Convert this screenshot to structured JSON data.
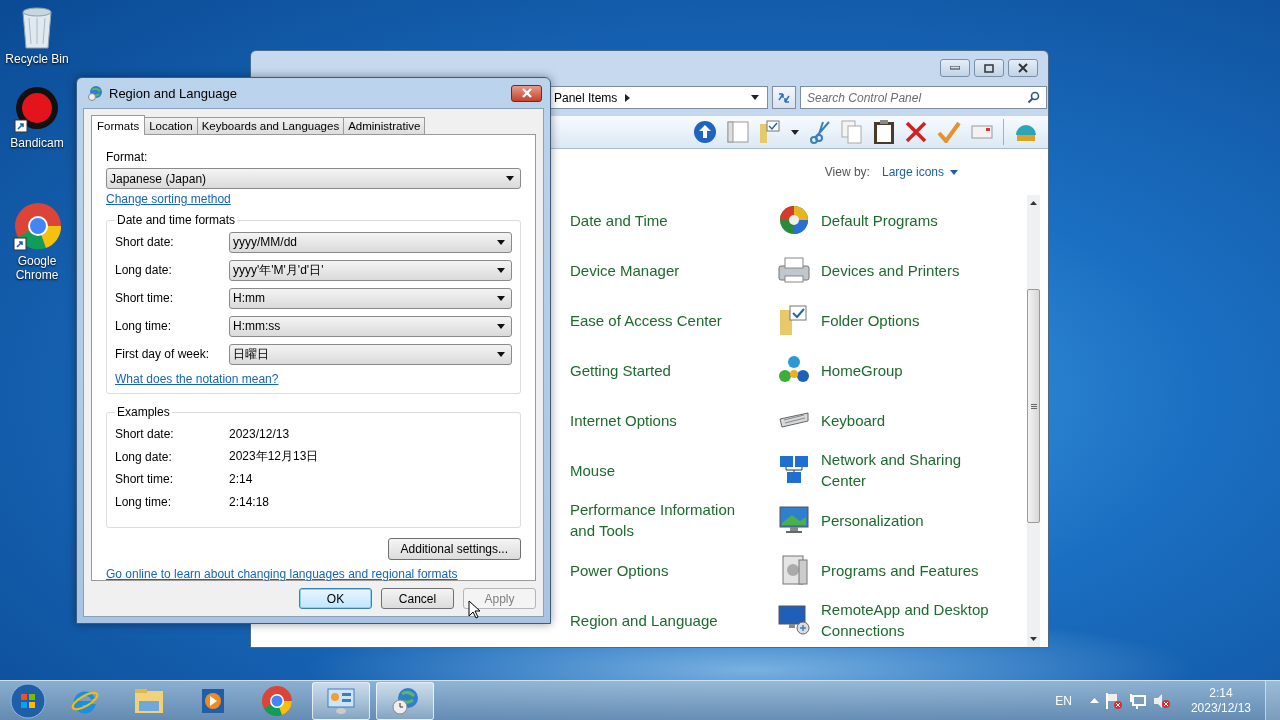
{
  "desktop_icons": [
    {
      "label": "Recycle Bin"
    },
    {
      "label": "Bandicam"
    },
    {
      "label": "Google Chrome"
    }
  ],
  "control_panel": {
    "address": "Panel Items",
    "search": {
      "placeholder": "Search Control Panel"
    },
    "view_by_label": "View by:",
    "view_by_value": "Large icons",
    "left_items": [
      "Date and Time",
      "Device Manager",
      "Ease of Access Center",
      "Getting Started",
      "Internet Options",
      "Mouse",
      "Performance Information and Tools",
      "Power Options",
      "Region and Language"
    ],
    "right_items": [
      "Default Programs",
      "Devices and Printers",
      "Folder Options",
      "HomeGroup",
      "Keyboard",
      "Network and Sharing Center",
      "Personalization",
      "Programs and Features",
      "RemoteApp and Desktop Connections"
    ]
  },
  "dialog": {
    "title": "Region and Language",
    "tabs": [
      {
        "label": "Formats",
        "selected": true
      },
      {
        "label": "Location",
        "selected": false
      },
      {
        "label": "Keyboards and Languages",
        "selected": false
      },
      {
        "label": "Administrative",
        "selected": false
      }
    ],
    "format_label": "Format:",
    "format_value": "Japanese (Japan)",
    "sorting_link": "Change sorting method",
    "formats_group": {
      "title": "Date and time formats",
      "rows": [
        {
          "label": "Short date:",
          "value": "yyyy/MM/dd"
        },
        {
          "label": "Long date:",
          "value": "yyyy'年'M'月'd'日'"
        },
        {
          "label": "Short time:",
          "value": "H:mm"
        },
        {
          "label": "Long time:",
          "value": "H:mm:ss"
        },
        {
          "label": "First day of week:",
          "value": "日曜日"
        }
      ]
    },
    "notation_link": "What does the notation mean?",
    "examples_group": {
      "title": "Examples",
      "rows": [
        {
          "label": "Short date:",
          "value": "2023/12/13"
        },
        {
          "label": "Long date:",
          "value": "2023年12月13日"
        },
        {
          "label": "Short time:",
          "value": "2:14"
        },
        {
          "label": "Long time:",
          "value": "2:14:18"
        }
      ]
    },
    "additional_button": "Additional settings...",
    "online_link": "Go online to learn about changing languages and regional formats",
    "buttons": [
      {
        "label": "OK",
        "default": true,
        "disabled": false
      },
      {
        "label": "Cancel",
        "default": false,
        "disabled": false
      },
      {
        "label": "Apply",
        "default": false,
        "disabled": true
      }
    ]
  },
  "taskbar": {
    "buttons": [
      {
        "kind": "ie",
        "active": false
      },
      {
        "kind": "explorer",
        "active": false
      },
      {
        "kind": "media",
        "active": false
      },
      {
        "kind": "chrome",
        "active": false
      },
      {
        "kind": "controlpanel",
        "active": true
      },
      {
        "kind": "region",
        "active": true
      }
    ],
    "language": "EN",
    "time": "2:14",
    "date": "2023/12/13"
  }
}
